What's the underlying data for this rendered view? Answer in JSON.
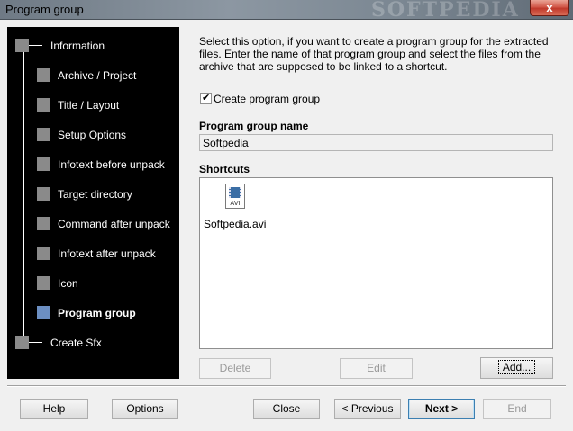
{
  "window": {
    "title": "Program group",
    "close_glyph": "x",
    "watermark": "SOFTPEDIA"
  },
  "sidebar": {
    "items": [
      {
        "label": "Information"
      },
      {
        "label": "Archive / Project"
      },
      {
        "label": "Title / Layout"
      },
      {
        "label": "Setup Options"
      },
      {
        "label": "Infotext before unpack"
      },
      {
        "label": "Target directory"
      },
      {
        "label": "Command after unpack"
      },
      {
        "label": "Infotext after unpack"
      },
      {
        "label": "Icon"
      },
      {
        "label": "Program group"
      },
      {
        "label": "Create Sfx"
      }
    ],
    "active": "Program group",
    "active_color": "#6c8fc2"
  },
  "main": {
    "description": "Select this option, if you want to create a program group for the extracted files. Enter the name of that program group and select the  files from the archive that are supposed to be linked to a shortcut.",
    "create_group_label": "Create program group",
    "create_group_checked": true,
    "check_glyph": "✔",
    "group_name_label": "Program group name",
    "group_name_value": "Softpedia",
    "shortcuts_label": "Shortcuts",
    "shortcuts": [
      {
        "name": "Softpedia.avi",
        "icon": "avi-file-icon",
        "icon_text": "AVI"
      }
    ],
    "delete_label": "Delete",
    "edit_label": "Edit",
    "add_label": "Add..."
  },
  "footer": {
    "help_label": "Help",
    "options_label": "Options",
    "close_label": "Close",
    "previous_label": "< Previous",
    "next_label": "Next >",
    "end_label": "End"
  }
}
